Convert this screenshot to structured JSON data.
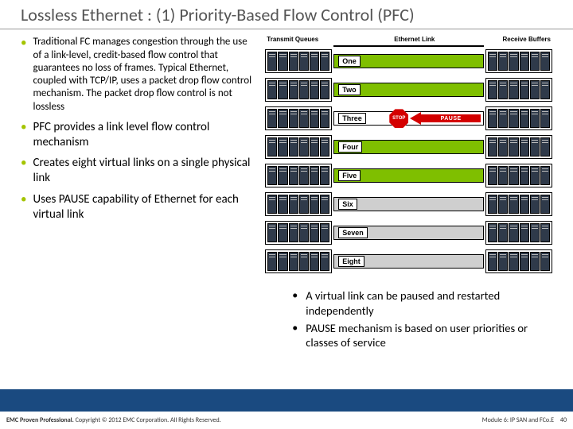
{
  "title": "Lossless Ethernet : (1) Priority-Based Flow Control (PFC)",
  "bullets": [
    "Traditional FC manages congestion through the use of a link-level, credit-based flow control that guarantees no loss of frames. Typical Ethernet, coupled with TCP/IP, uses a packet drop flow control mechanism. The packet drop flow control is not lossless",
    "PFC provides a link level flow control mechanism",
    "Creates eight virtual links on a single physical link",
    "Uses PAUSE capability of Ethernet for each virtual link"
  ],
  "sub_bullets": [
    "A virtual link can be paused and restarted independently",
    "PAUSE mechanism is based on user priorities or classes of service"
  ],
  "diagram": {
    "headers": {
      "tq": "Transmit Queues",
      "el": "Ethernet Link",
      "rb": "Receive Buffers"
    },
    "lanes": [
      "One",
      "Two",
      "Three",
      "Four",
      "Five",
      "Six",
      "Seven",
      "Eight"
    ],
    "stop": "STOP",
    "pause": "PAUSE"
  },
  "footer": {
    "pp": "EMC Proven Professional.",
    "copy": " Copyright © 2012 EMC Corporation. All Rights Reserved.",
    "module": "Module 6: IP SAN and FCo.E",
    "page": "40"
  }
}
